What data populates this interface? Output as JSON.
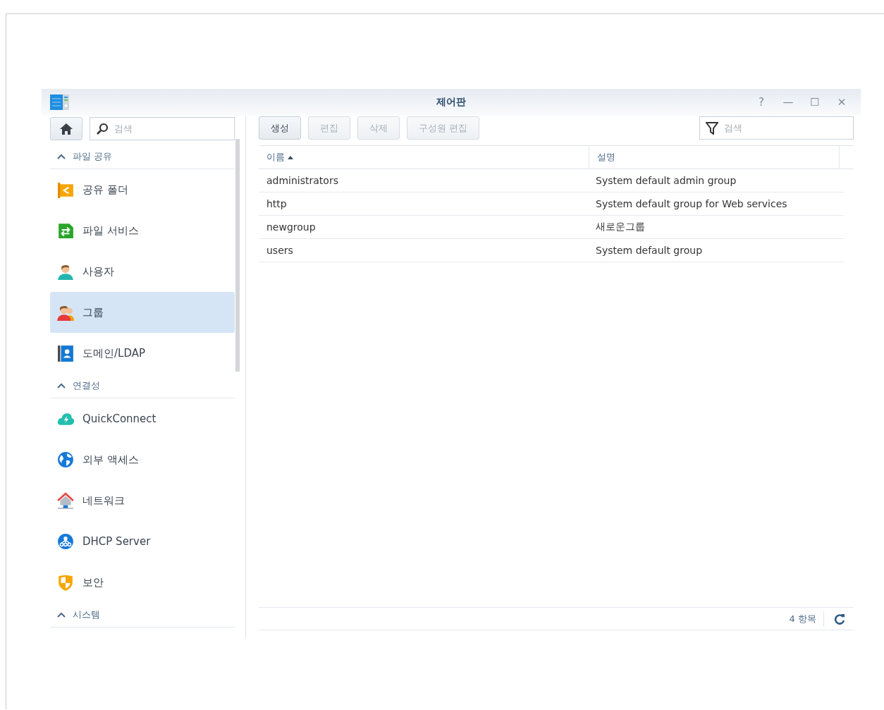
{
  "window": {
    "title": "제어판",
    "controls": [
      "?",
      "—",
      "☐",
      "✕"
    ]
  },
  "sidebar": {
    "search": {
      "placeholder": "검색"
    },
    "items": [
      {
        "kind": "section",
        "label": "파일 공유",
        "expanded": true
      },
      {
        "kind": "item",
        "label": "공유 폴더",
        "selected": false
      },
      {
        "kind": "item",
        "label": "파일 서비스",
        "selected": false
      },
      {
        "kind": "item",
        "label": "사용자",
        "selected": false
      },
      {
        "kind": "item",
        "label": "그룹",
        "selected": true
      },
      {
        "kind": "item",
        "label": "도메인/LDAP",
        "selected": false
      },
      {
        "kind": "section",
        "label": "연결성",
        "expanded": true
      },
      {
        "kind": "item",
        "label": "QuickConnect",
        "selected": false
      },
      {
        "kind": "item",
        "label": "외부 액세스",
        "selected": false
      },
      {
        "kind": "item",
        "label": "네트워크",
        "selected": false
      },
      {
        "kind": "item",
        "label": "DHCP Server",
        "selected": false
      },
      {
        "kind": "item",
        "label": "보안",
        "selected": false
      },
      {
        "kind": "section",
        "label": "시스템",
        "expanded": true
      }
    ]
  },
  "toolbar": {
    "buttons": [
      {
        "label": "생성",
        "disabled": false
      },
      {
        "label": "편집",
        "disabled": true
      },
      {
        "label": "삭제",
        "disabled": true
      },
      {
        "label": "구성원 편집",
        "disabled": true
      }
    ],
    "filter": {
      "placeholder": "검색"
    }
  },
  "table": {
    "columns": [
      {
        "label": "이름",
        "sorted": true
      },
      {
        "label": "설명",
        "sorted": false
      }
    ],
    "rows": [
      [
        "administrators",
        "System default admin group"
      ],
      [
        "http",
        "System default group for Web services"
      ],
      [
        "newgroup",
        "새로운그룹"
      ],
      [
        "users",
        "System default group"
      ]
    ]
  },
  "status_bar": {
    "count": "4 항목"
  }
}
